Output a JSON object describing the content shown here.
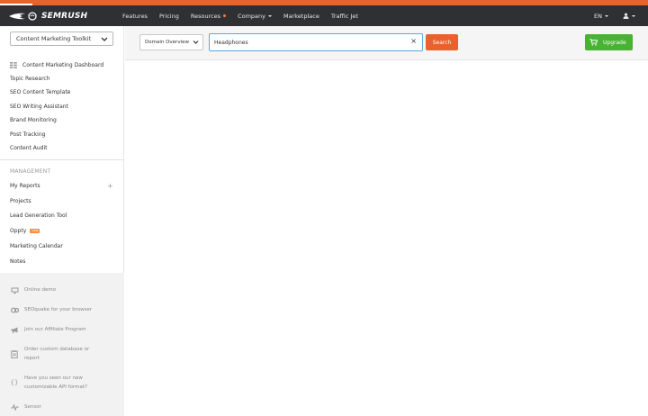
{
  "brand": {
    "name": "SEMRUSH",
    "accent": "#e8622b",
    "header_bg": "#2e3033",
    "upgrade_color": "#48b332"
  },
  "nav": {
    "items": [
      {
        "label": "Features"
      },
      {
        "label": "Pricing"
      },
      {
        "label": "Resources"
      },
      {
        "label": "Company"
      },
      {
        "label": "Marketplace"
      },
      {
        "label": "Traffic Jet"
      }
    ],
    "language": "EN"
  },
  "sidebar": {
    "toolkit": "Content Marketing Toolkit",
    "dashboard": "Content Marketing Dashboard",
    "tools": [
      "Topic Research",
      "SEO Content Template",
      "SEO Writing Assistant",
      "Brand Monitoring",
      "Post Tracking",
      "Content Audit"
    ],
    "management_title": "MANAGEMENT",
    "management": [
      "My Reports",
      "Projects",
      "Lead Generation Tool",
      "Oppty",
      "Marketing Calendar",
      "Notes"
    ],
    "oppty_badge": "new",
    "promos": [
      {
        "label": "Online demo",
        "icon": "monitor-icon"
      },
      {
        "label": "SEOquake for your browser",
        "icon": "seoquake-icon"
      },
      {
        "label": "Join our Affiliate Program",
        "icon": "megaphone-icon"
      },
      {
        "label_l1": "Order custom database or",
        "label_l2": "report",
        "icon": "clipboard-icon"
      },
      {
        "label_l1": "Have you seen our new",
        "label_l2": "customizable API format?",
        "icon": "braces-icon"
      },
      {
        "label": "Sensor",
        "icon": "pulse-icon"
      }
    ]
  },
  "search": {
    "database_label": "Domain Overview",
    "query": "Headphones",
    "button": "Search",
    "upgrade": "Upgrade"
  }
}
